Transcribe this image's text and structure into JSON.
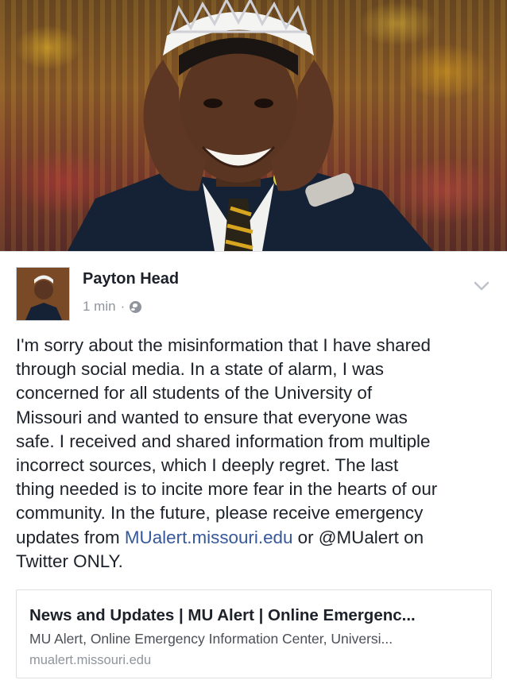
{
  "post": {
    "author": "Payton Head",
    "timestamp": "1 min",
    "separator": "·",
    "privacy_icon": "globe-icon",
    "menu_icon": "chevron-down-icon",
    "body_before_link": "I'm sorry about the misinformation that I have shared\nthrough social media. In a state of alarm, I was\nconcerned for all students of the University of\nMissouri and wanted to ensure that everyone was\nsafe. I received and shared information from multiple\nincorrect sources, which I deeply regret. The last\nthing needed is to incite more fear in the hearts of our\ncommunity. In the future, please receive emergency\nupdates from ",
    "body_link": "MUalert.missouri.edu",
    "body_after_link": " or @MUalert on\nTwitter ONLY."
  },
  "link_preview": {
    "title": "News and Updates | MU Alert | Online Emergenc...",
    "description": "MU Alert, Online Emergency Information Center, Universi...",
    "domain": "mualert.missouri.edu"
  },
  "colors": {
    "link": "#365899",
    "meta": "#90949c",
    "text": "#1d2129"
  }
}
